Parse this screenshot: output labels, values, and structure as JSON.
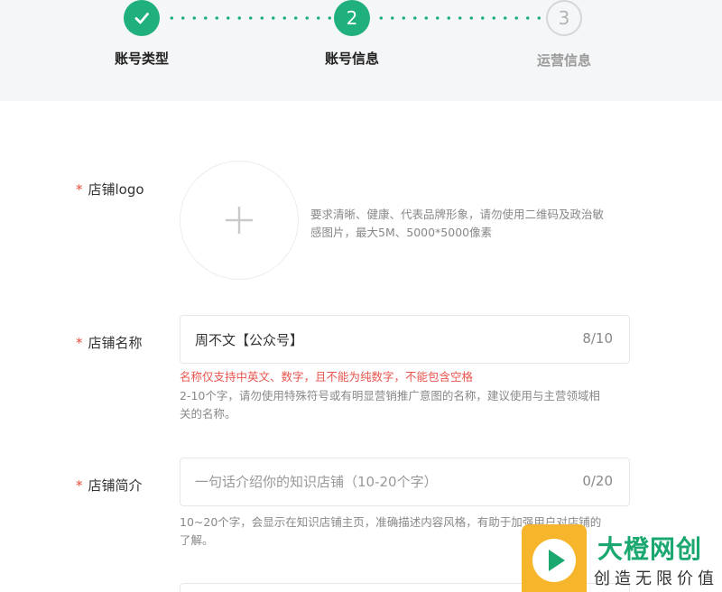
{
  "steps": [
    {
      "label": "账号类型",
      "state": "done"
    },
    {
      "label": "账号信息",
      "number": "2",
      "state": "active"
    },
    {
      "label": "运营信息",
      "number": "3",
      "state": "pending"
    }
  ],
  "logo_field": {
    "label": "店铺logo",
    "required_mark": "*",
    "hint_line1": "要求清晰、健康、代表品牌形象，请勿使用二维码及政治敏",
    "hint_line2": "感图片，最大5M、5000*5000像素"
  },
  "name_field": {
    "label": "店铺名称",
    "required_mark": "*",
    "value": "周不文【公众号】",
    "counter": "8/10",
    "error": "名称仅支持中英文、数字，且不能为纯数字，不能包含空格",
    "hint_line1": "2-10个字，请勿使用特殊符号或有明显营销推广意图的名称，建议使用与主营领域相",
    "hint_line2": "关的名称。"
  },
  "intro_field": {
    "label": "店铺简介",
    "required_mark": "*",
    "placeholder": "一句话介绍你的知识店铺（10-20个字）",
    "counter": "0/20",
    "hint_line1": "10~20个字，会显示在知识店铺主页，准确描述内容风格，有助于加强用户对店铺的",
    "hint_line2": "了解。"
  },
  "watermark": {
    "title": "大橙网创",
    "subtitle": "创造无限价值"
  },
  "colors": {
    "accent": "#1fb07d",
    "error": "#e8554e",
    "watermark_orange": "#f7b52b"
  }
}
